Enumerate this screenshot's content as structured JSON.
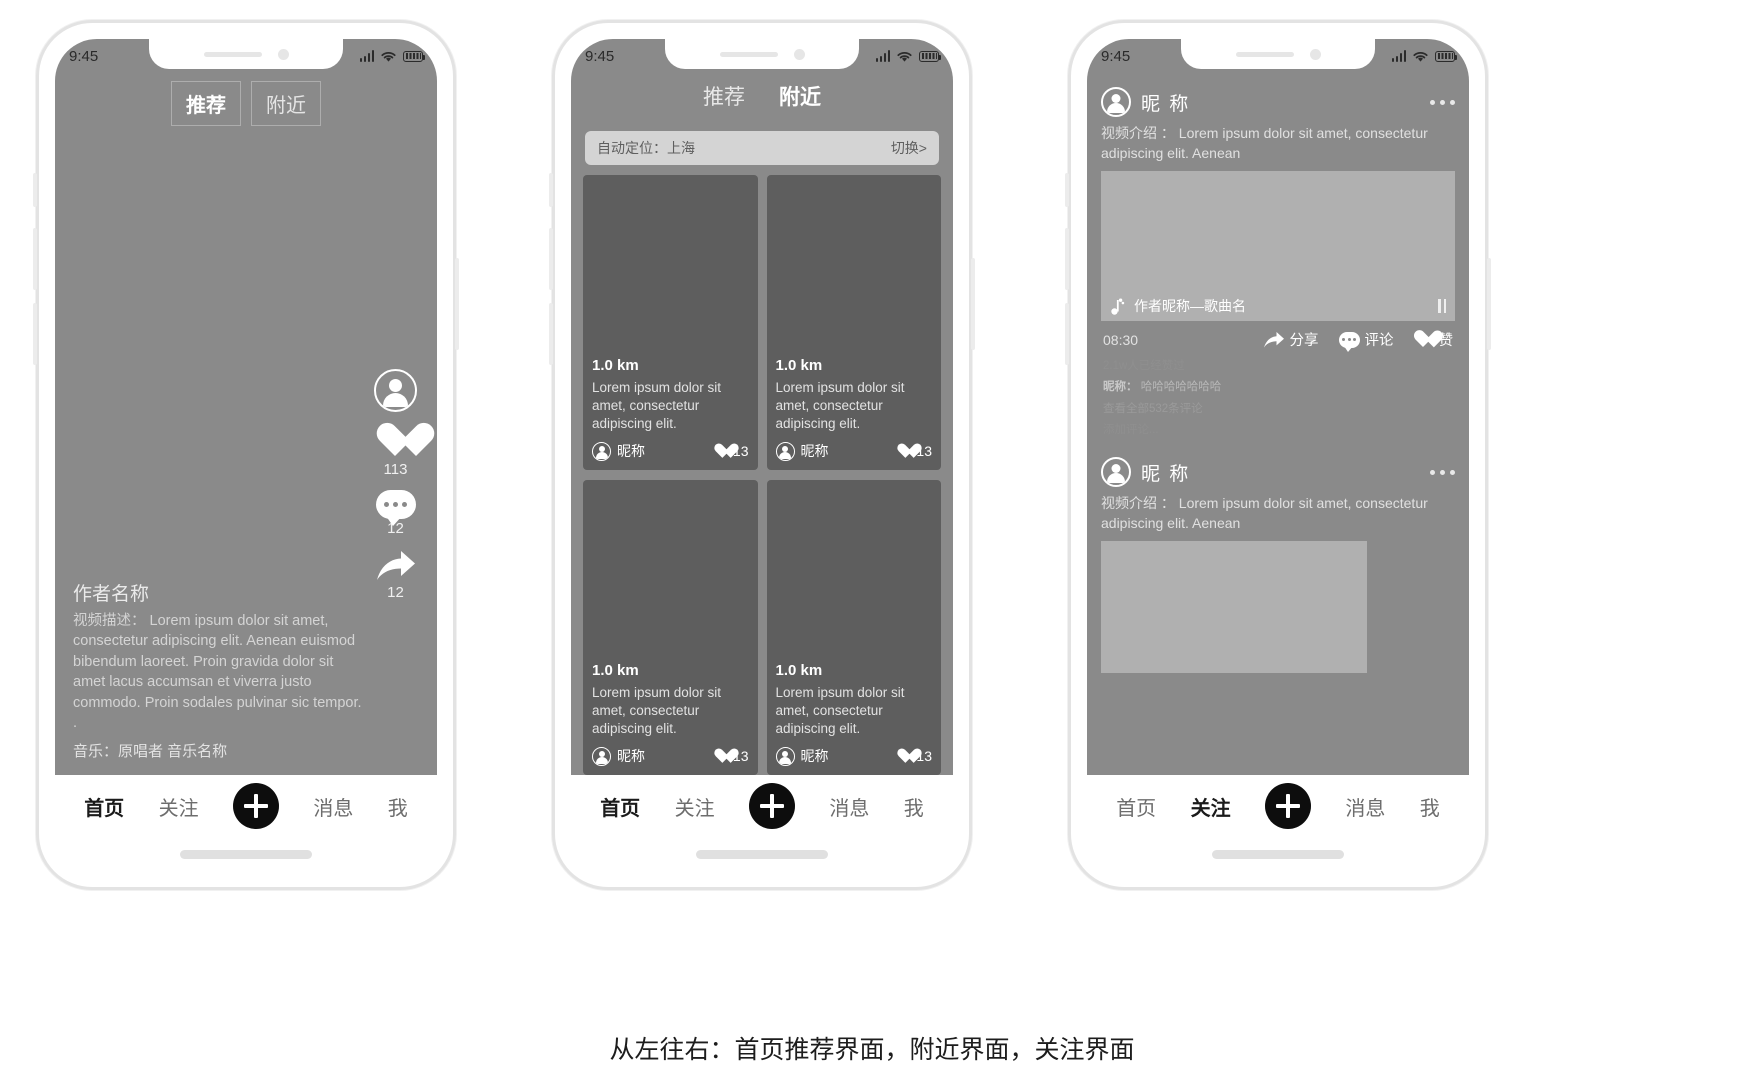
{
  "figure": {
    "caption": "从左往右：首页推荐界面，附近界面，关注界面"
  },
  "status_bar": {
    "time": "9:45",
    "signal_icon": "signal-bars-icon",
    "wifi_icon": "wifi-icon",
    "battery_icon": "battery-icon"
  },
  "bottom_nav": {
    "items": [
      {
        "label": "首页"
      },
      {
        "label": "关注"
      },
      {
        "label": "plus"
      },
      {
        "label": "消息"
      },
      {
        "label": "我"
      }
    ],
    "plus_icon": "plus-icon"
  },
  "phone1": {
    "name": "首页推荐界面",
    "tabs": [
      {
        "label": "推荐",
        "active": true
      },
      {
        "label": "附近",
        "active": false
      }
    ],
    "rail": {
      "avatar_icon": "user-avatar-icon",
      "like": {
        "icon": "heart-icon",
        "count": "113"
      },
      "comment": {
        "icon": "comment-bubble-icon",
        "count": "12"
      },
      "share": {
        "icon": "share-arrow-icon",
        "count": "12"
      }
    },
    "caption": {
      "author": "作者名称",
      "description": "视频描述： Lorem ipsum dolor sit amet, consectetur adipiscing elit. Aenean euismod bibendum laoreet. Proin gravida dolor sit amet lacus accumsan et viverra justo commodo. Proin sodales pulvinar sic tempor. .",
      "music": "音乐：原唱者 音乐名称"
    },
    "active_nav": "首页"
  },
  "phone2": {
    "name": "附近界面",
    "tabs": [
      {
        "label": "推荐",
        "active": false
      },
      {
        "label": "附近",
        "active": true
      }
    ],
    "location_bar": {
      "text": "自动定位：上海",
      "switch_label": "切换>"
    },
    "cards": [
      {
        "distance": "1.0 km",
        "text": "Lorem ipsum dolor sit amet, consectetur adipiscing elit.",
        "user": "昵称",
        "likes": "13"
      },
      {
        "distance": "1.0 km",
        "text": "Lorem ipsum dolor sit amet, consectetur adipiscing elit.",
        "user": "昵称",
        "likes": "13"
      },
      {
        "distance": "1.0 km",
        "text": "Lorem ipsum dolor sit amet, consectetur adipiscing elit.",
        "user": "昵称",
        "likes": "13"
      },
      {
        "distance": "1.0 km",
        "text": "Lorem ipsum dolor sit amet, consectetur adipiscing elit.",
        "user": "昵称",
        "likes": "13"
      }
    ],
    "active_nav": "首页"
  },
  "phone3": {
    "name": "关注界面",
    "posts": [
      {
        "user": "昵 称",
        "more_icon": "more-dots-icon",
        "description": "视频介绍 ： Lorem ipsum dolor sit amet, consectetur adipiscing elit. Aenean",
        "song": "作者昵称—歌曲名",
        "music_icon": "music-note-icon",
        "pause_icon": "pause-icon",
        "time": "08:30",
        "actions": [
          {
            "icon": "share-arrow-icon",
            "label": "分享"
          },
          {
            "icon": "comment-bubble-icon",
            "label": "评论"
          },
          {
            "icon": "heart-icon",
            "label": "赞"
          }
        ],
        "likes_line": "2.1w人已经赞过",
        "comment_user": "昵称：",
        "comment_text": "哈哈哈哈哈哈哈",
        "view_all": "查看全部532条评论",
        "add_comment": "添加评论...",
        "add_comment_icon": "pencil-icon"
      },
      {
        "user": "昵 称",
        "more_icon": "more-dots-icon",
        "description": "视频介绍 ： Lorem ipsum dolor sit amet, consectetur adipiscing elit. Aenean"
      }
    ],
    "active_nav": "关注"
  }
}
